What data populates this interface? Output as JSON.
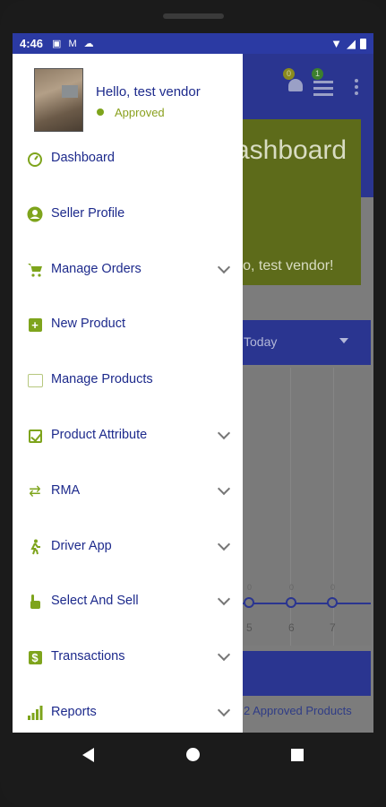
{
  "status_bar": {
    "time": "4:46",
    "icons": [
      "sim-icon",
      "gmail-icon",
      "cloud-icon",
      "wifi-icon",
      "signal-icon",
      "battery-icon"
    ]
  },
  "background": {
    "dashboard_title": "ashboard",
    "dashboard_subtitle": "llo, test vendor!",
    "notification_badge": "0",
    "menu_badge": "1",
    "filter_value": "Today",
    "chart_values": [
      "0",
      "0",
      "0"
    ],
    "chart_x_labels": [
      "5",
      "6",
      "7"
    ],
    "approved_products_link": "2 Approved Products"
  },
  "drawer": {
    "greeting": "Hello, test vendor",
    "status": "Approved",
    "status_color": "#7ea41c",
    "items": [
      {
        "label": "Dashboard",
        "icon": "dashboard-icon",
        "expandable": false
      },
      {
        "label": "Seller Profile",
        "icon": "account-icon",
        "expandable": false
      },
      {
        "label": "Manage Orders",
        "icon": "cart-icon",
        "expandable": true
      },
      {
        "label": "New Product",
        "icon": "add-box-icon",
        "expandable": false
      },
      {
        "label": "Manage Products",
        "icon": "products-icon",
        "expandable": false
      },
      {
        "label": "Product Attribute",
        "icon": "checkbox-icon",
        "expandable": true
      },
      {
        "label": "RMA",
        "icon": "swap-icon",
        "expandable": true
      },
      {
        "label": "Driver App",
        "icon": "walking-icon",
        "expandable": true
      },
      {
        "label": "Select And Sell",
        "icon": "hand-pointer-icon",
        "expandable": true
      },
      {
        "label": "Transactions",
        "icon": "dollar-icon",
        "expandable": true
      },
      {
        "label": "Reports",
        "icon": "bar-chart-icon",
        "expandable": true
      }
    ]
  },
  "colors": {
    "primary": "#2b3aa3",
    "accent": "#7ea41c",
    "drawer_text": "#1d2a8c"
  }
}
